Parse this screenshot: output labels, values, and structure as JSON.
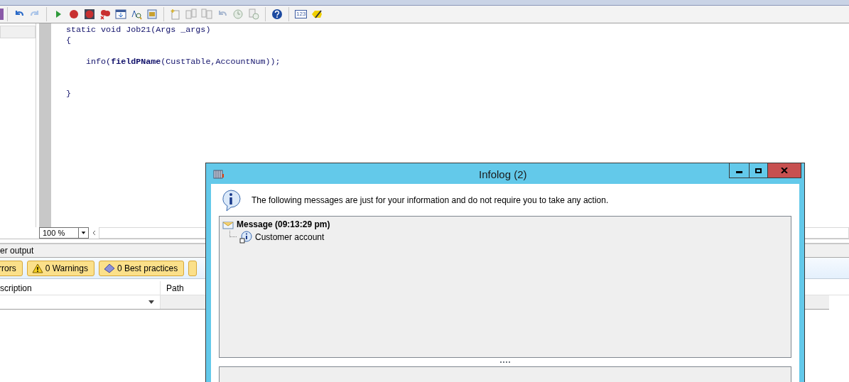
{
  "toolbar": {
    "number_format_label": "123"
  },
  "editor": {
    "code": "static void Job21(Args _args)\n{\n\n    info(**fieldPName**(CustTable,AccountNum));\n\n\n}"
  },
  "zoom": {
    "value": "100 %"
  },
  "output": {
    "title": "er output",
    "filters": [
      {
        "kind": "error",
        "label": "rrors"
      },
      {
        "kind": "warning",
        "label": "0 Warnings"
      },
      {
        "kind": "best_practice",
        "label": "0 Best practices"
      }
    ],
    "columns": [
      "scription",
      "Path"
    ]
  },
  "infolog": {
    "title": "Infolog (2)",
    "intro": "The following messages are just for your information and do not require you to take any action.",
    "tree": [
      {
        "kind": "message",
        "text": "Message (09:13:29 pm)",
        "children": [
          {
            "kind": "info",
            "text": "Customer account"
          }
        ]
      }
    ]
  }
}
